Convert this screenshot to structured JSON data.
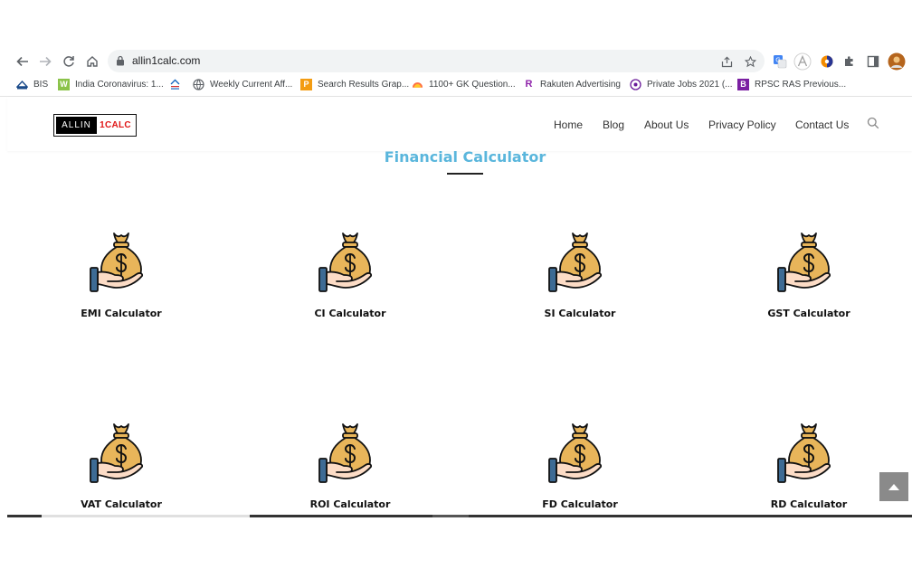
{
  "browser": {
    "url": "allin1calc.com",
    "bookmarks": [
      {
        "label": "BIS",
        "icon": "bis-icon"
      },
      {
        "label": "India Coronavirus: 1...",
        "icon": "coronavirus-site-icon"
      },
      {
        "label": "",
        "icon": "news-site-icon"
      },
      {
        "label": "Weekly Current Aff...",
        "icon": "globe-icon"
      },
      {
        "label": "Search Results Grap...",
        "icon": "graphics-site-icon"
      },
      {
        "label": "1100+ GK Question...",
        "icon": "sunrise-icon"
      },
      {
        "label": "Rakuten Advertising",
        "icon": "rakuten-icon"
      },
      {
        "label": "Private Jobs 2021 (...",
        "icon": "jobs-site-icon"
      },
      {
        "label": "RPSC RAS Previous...",
        "icon": "rpsc-site-icon"
      }
    ]
  },
  "site": {
    "logo_left": "ALLIN",
    "logo_right": "1CALC",
    "nav": [
      "Home",
      "Blog",
      "About Us",
      "Privacy Policy",
      "Contact Us"
    ],
    "section_title": "Financial Calculator",
    "calculators": [
      {
        "label": "EMI Calculator"
      },
      {
        "label": "CI Calculator"
      },
      {
        "label": "SI Calculator"
      },
      {
        "label": "GST Calculator"
      },
      {
        "label": "VAT Calculator"
      },
      {
        "label": "ROI Calculator"
      },
      {
        "label": "FD Calculator"
      },
      {
        "label": "RD Calculator"
      }
    ]
  },
  "colors": {
    "title": "#5ab6dc",
    "logo_accent": "#e01515",
    "money_bag": "#e8b55a",
    "hand": "#fcdcc6",
    "sleeve": "#3d6b94"
  }
}
